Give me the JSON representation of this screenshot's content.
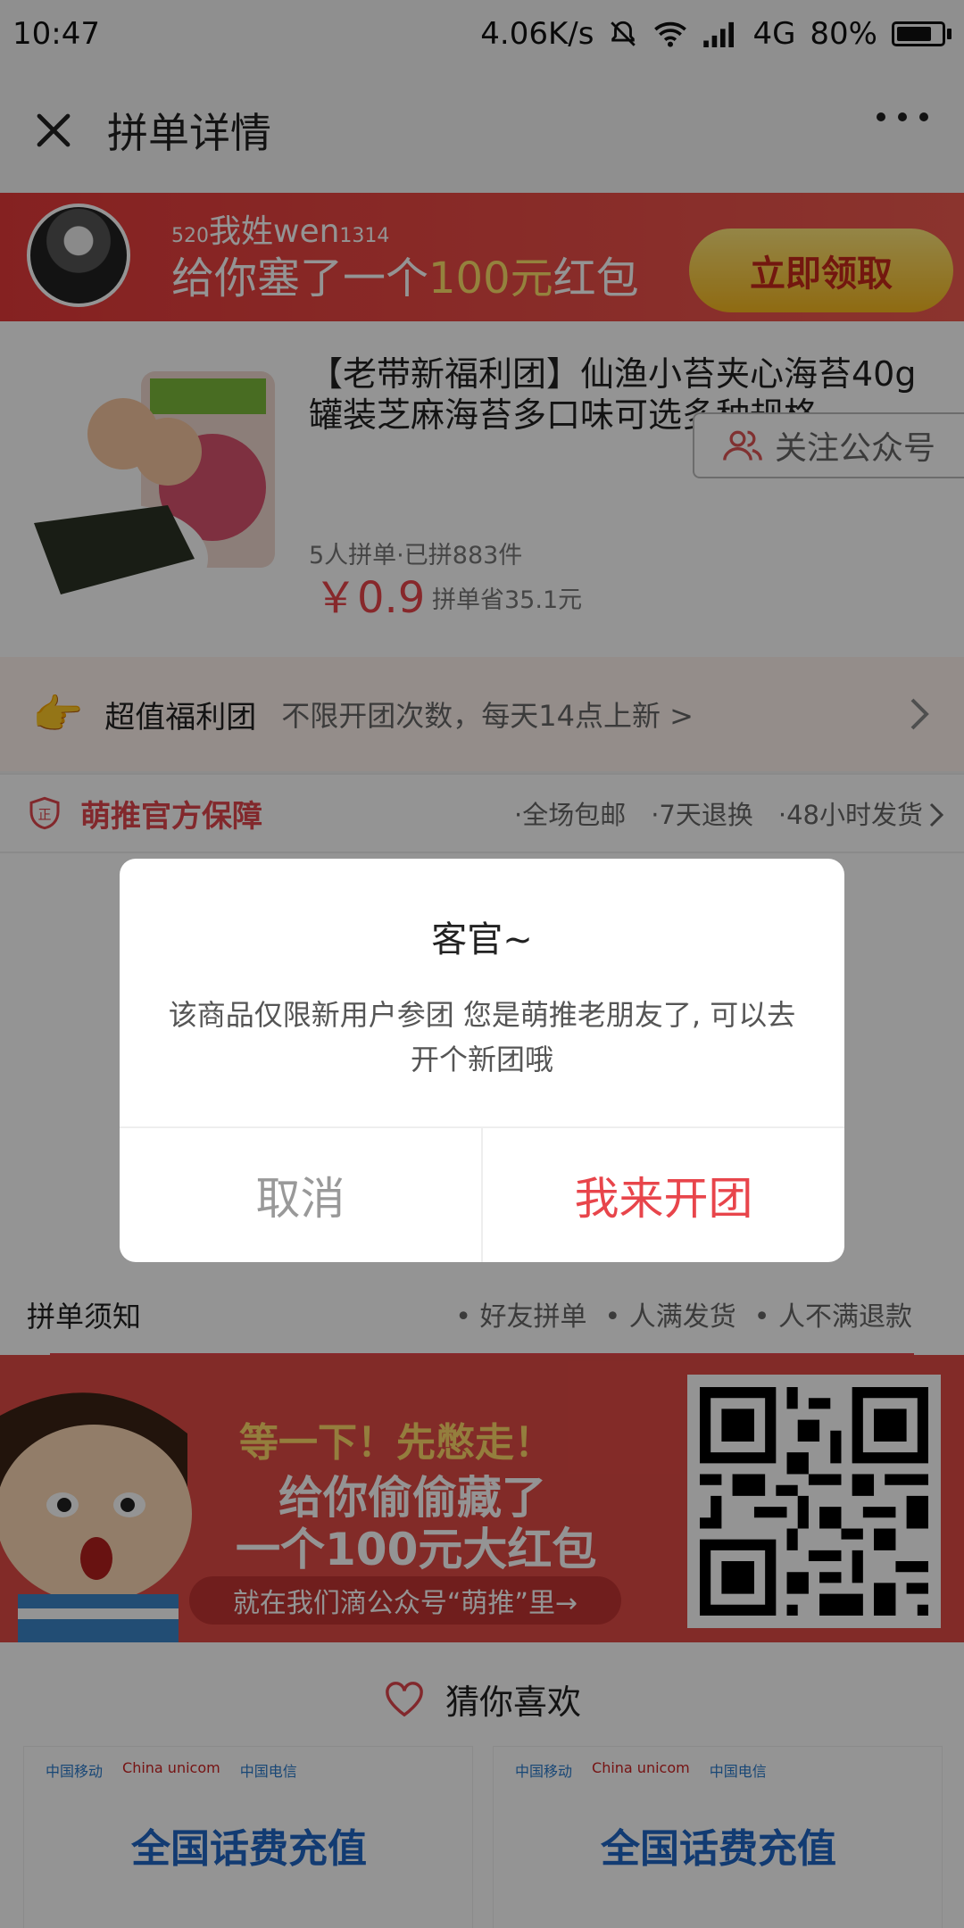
{
  "status_bar": {
    "time": "10:47",
    "speed": "4.06K/s",
    "network": "4G",
    "battery": "80%"
  },
  "nav": {
    "title": "拼单详情"
  },
  "promo": {
    "user_prefix": "520",
    "user_name": "我姓wen",
    "user_suffix": "1314",
    "message_pre": "给你塞了一个",
    "message_amount": "100元",
    "message_post": "红包",
    "button": "立即领取"
  },
  "product": {
    "title": "【老带新福利团】仙渔小苔夹心海苔40g罐装芝麻海苔多口味可选多种规格",
    "follow_button": "关注公众号",
    "meta": "5人拼单·已拼883件",
    "price": "￥0.9",
    "save": "拼单省35.1元"
  },
  "welfare": {
    "label": "超值福利团",
    "desc": "不限开团次数，每天14点上新 >"
  },
  "guarantee": {
    "title": "萌推官方保障",
    "items": [
      "·全场包邮",
      "·7天退换",
      "·48小时发货"
    ]
  },
  "notice": {
    "title": "拼单须知",
    "items": [
      "• 好友拼单",
      "• 人满发货",
      "• 人不满退款"
    ]
  },
  "banner": {
    "line1": "等一下！先憋走！",
    "line2": "给你偷偷藏了",
    "line3": "一个100元大红包",
    "line4": "就在我们滴公众号“萌推”里→"
  },
  "guess": {
    "title": "猜你喜欢",
    "cards": [
      {
        "logos": [
          "中国移动",
          "China unicom",
          "中国电信"
        ],
        "title": "全国话费充值"
      },
      {
        "logos": [
          "中国移动",
          "China unicom",
          "中国电信"
        ],
        "title": "全国话费充值"
      }
    ]
  },
  "dialog": {
    "title": "客官~",
    "message": "该商品仅限新用户参团 您是萌推老朋友了, 可以去开个新团哦",
    "cancel": "取消",
    "confirm": "我来开团"
  }
}
